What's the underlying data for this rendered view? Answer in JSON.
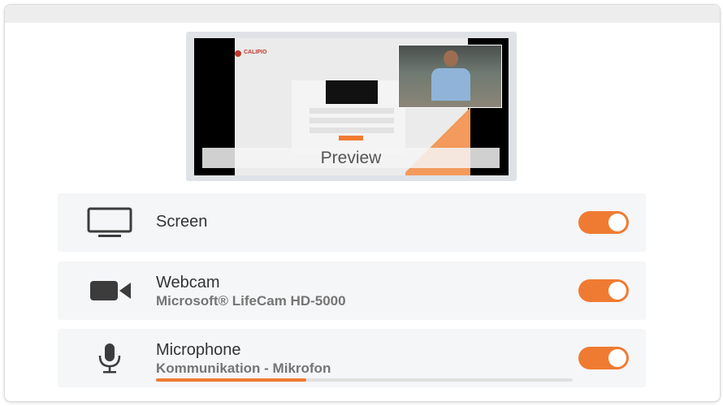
{
  "colors": {
    "accent": "#ef7b32",
    "row_bg": "#f5f6f8",
    "preview_frame": "#dfe3e8",
    "icon": "#3c3c3c"
  },
  "preview": {
    "label": "Preview",
    "mini_logo": "CALIPIO"
  },
  "sources": {
    "screen": {
      "title": "Screen",
      "icon": "monitor-icon",
      "enabled": true
    },
    "webcam": {
      "title": "Webcam",
      "device": "Microsoft® LifeCam HD-5000",
      "icon": "video-camera-icon",
      "enabled": true
    },
    "microphone": {
      "title": "Microphone",
      "device": "Kommunikation - Mikrofon",
      "icon": "microphone-icon",
      "enabled": true,
      "input_level": 0.36
    }
  }
}
